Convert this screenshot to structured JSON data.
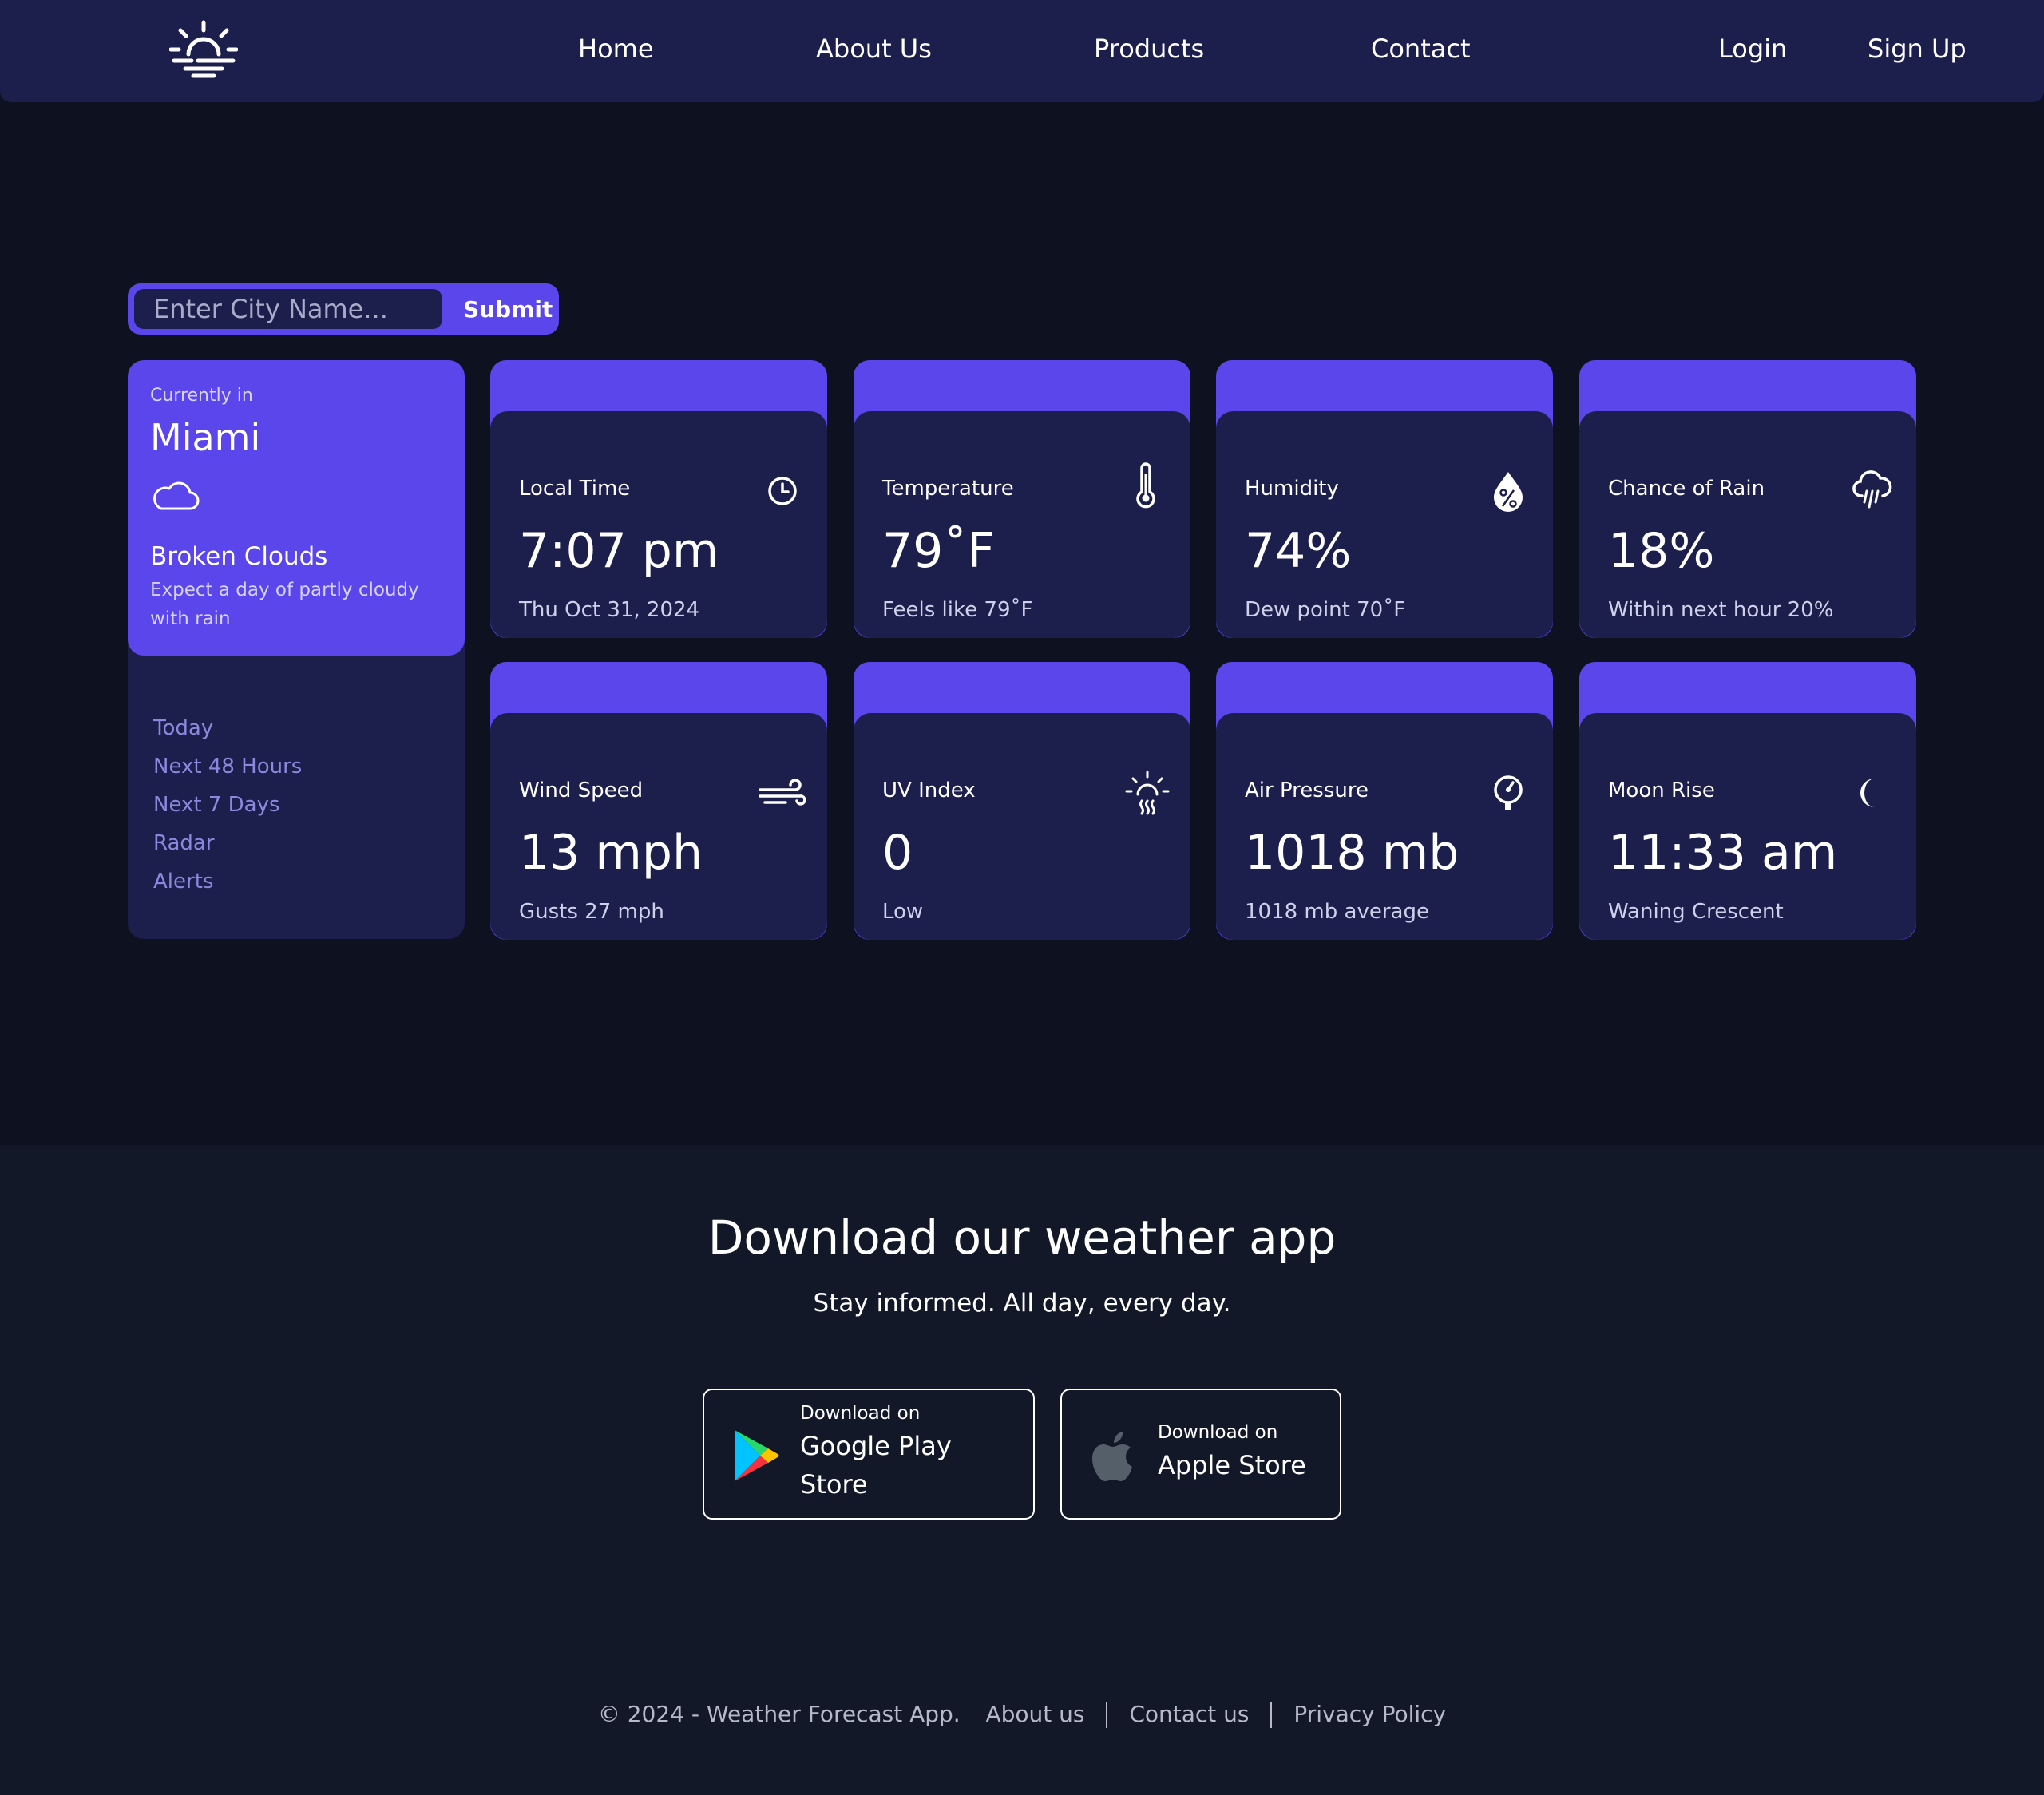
{
  "nav": {
    "links": [
      "Home",
      "About Us",
      "Products",
      "Contact"
    ],
    "login": "Login",
    "signup": "Sign Up",
    "logo_icon": "sunrise-icon"
  },
  "search": {
    "placeholder": "Enter City Name...",
    "submit": "Submit"
  },
  "current": {
    "label": "Currently in",
    "city": "Miami",
    "icon": "cloud-icon",
    "condition": "Broken Clouds",
    "description": "Expect a day of partly cloudy with rain"
  },
  "sidebar_links": [
    "Today",
    "Next 48 Hours",
    "Next 7 Days",
    "Radar",
    "Alerts"
  ],
  "stats": [
    {
      "title": "Local Time",
      "value": "7:07 pm",
      "sub": "Thu Oct 31, 2024",
      "icon": "clock-icon"
    },
    {
      "title": "Temperature",
      "value": "79˚F",
      "sub": "Feels like 79˚F",
      "icon": "thermometer-icon"
    },
    {
      "title": "Humidity",
      "value": "74%",
      "sub": "Dew point 70˚F",
      "icon": "humidity-drop-icon"
    },
    {
      "title": "Chance of Rain",
      "value": "18%",
      "sub": "Within next hour 20%",
      "icon": "rain-cloud-icon"
    },
    {
      "title": "Wind Speed",
      "value": "13 mph",
      "sub": "Gusts 27 mph",
      "icon": "wind-icon"
    },
    {
      "title": "UV Index",
      "value": "0",
      "sub": "Low",
      "icon": "uv-sun-icon"
    },
    {
      "title": "Air Pressure",
      "value": "1018 mb",
      "sub": "1018 mb average",
      "icon": "pressure-gauge-icon"
    },
    {
      "title": "Moon Rise",
      "value": "11:33 am",
      "sub": "Waning Crescent",
      "icon": "moon-icon"
    }
  ],
  "download": {
    "title": "Download our weather app",
    "subtitle": "Stay informed. All day, every day.",
    "google": {
      "small": "Download on",
      "line1": "Google Play",
      "line2": "Store"
    },
    "apple": {
      "small": "Download on",
      "big": "Apple Store"
    }
  },
  "footer": {
    "copyright": "© 2024 - Weather Forecast App.",
    "links": [
      "About us",
      "Contact us",
      "Privacy Policy"
    ]
  },
  "colors": {
    "accent": "#5a46ea",
    "card": "#1c1f4c",
    "background": "#0d1120",
    "footer_bg": "#121828"
  }
}
